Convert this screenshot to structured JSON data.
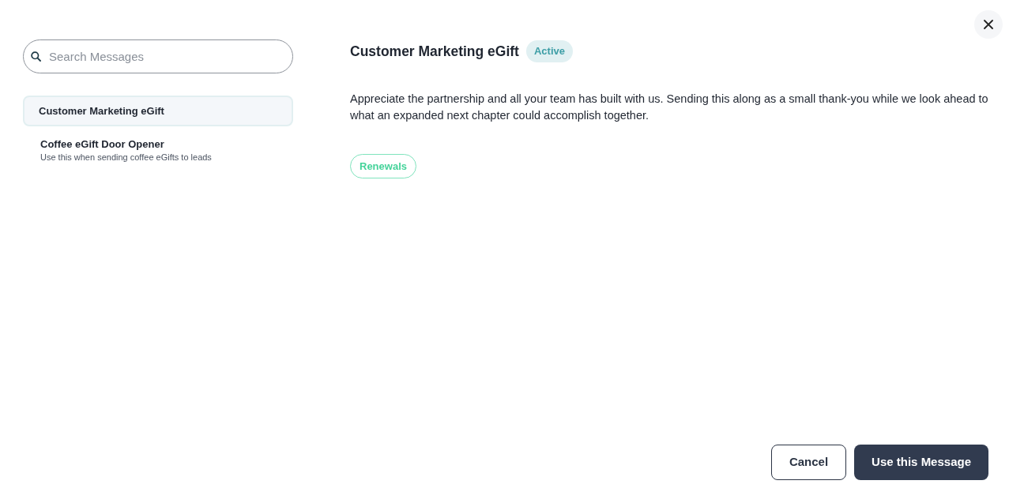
{
  "search": {
    "placeholder": "Search Messages"
  },
  "messages": [
    {
      "title": "Customer Marketing eGift",
      "selected": true
    },
    {
      "title": "Coffee eGift Door Opener",
      "description": "Use this when sending coffee eGifts to leads",
      "selected": false
    }
  ],
  "detail": {
    "title": "Customer Marketing eGift",
    "status": "Active",
    "body": "Appreciate the partnership and all your team has built with us. Sending this along as a small thank-you while we look ahead to what an expanded next chapter could accomplish together.",
    "tags": [
      "Renewals"
    ]
  },
  "buttons": [
    {
      "label": "Cancel",
      "kind": "secondary"
    },
    {
      "label": "Use this Message",
      "kind": "primary"
    }
  ]
}
